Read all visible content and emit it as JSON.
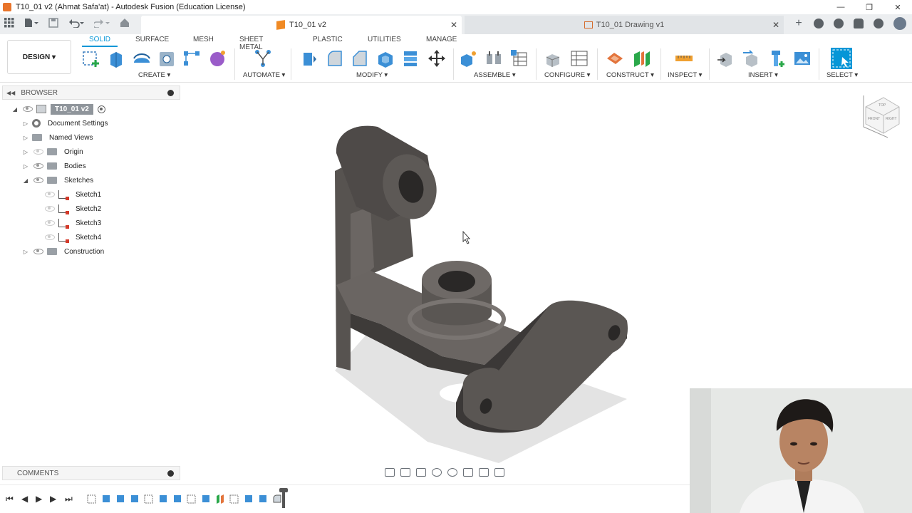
{
  "window": {
    "title": "T10_01 v2 (Ahmat Safa'at) - Autodesk Fusion (Education License)",
    "controls": [
      "—",
      "❐",
      "✕"
    ]
  },
  "tabs": {
    "active": "T10_01 v2",
    "inactive": "T10_01 Drawing v1"
  },
  "ribbon": {
    "workspace": "DESIGN",
    "tabs": [
      "SOLID",
      "SURFACE",
      "MESH",
      "SHEET METAL",
      "PLASTIC",
      "UTILITIES",
      "MANAGE"
    ],
    "groups": {
      "create": "CREATE",
      "automate": "AUTOMATE",
      "modify": "MODIFY",
      "assemble": "ASSEMBLE",
      "configure": "CONFIGURE",
      "construct": "CONSTRUCT",
      "inspect": "INSPECT",
      "insert": "INSERT",
      "select": "SELECT"
    }
  },
  "browser": {
    "title": "BROWSER",
    "root": "T10_01 v2",
    "items": [
      {
        "label": "Document Settings",
        "icon": "gear-icon"
      },
      {
        "label": "Named Views",
        "icon": "folder-icon"
      },
      {
        "label": "Origin",
        "icon": "folder-icon"
      },
      {
        "label": "Bodies",
        "icon": "folder-icon"
      },
      {
        "label": "Sketches",
        "icon": "folder-icon"
      },
      {
        "label": "Sketch1",
        "icon": "sketch-icon"
      },
      {
        "label": "Sketch2",
        "icon": "sketch-icon"
      },
      {
        "label": "Sketch3",
        "icon": "sketch-icon"
      },
      {
        "label": "Sketch4",
        "icon": "sketch-icon"
      },
      {
        "label": "Construction",
        "icon": "folder-icon"
      }
    ]
  },
  "comments": {
    "title": "COMMENTS"
  },
  "viewcube": {
    "faces": [
      "TOP",
      "FRONT",
      "RIGHT"
    ]
  },
  "colors": {
    "accent": "#0696d7",
    "part": "#5e5a58",
    "doc_icon": "#f08a24"
  }
}
